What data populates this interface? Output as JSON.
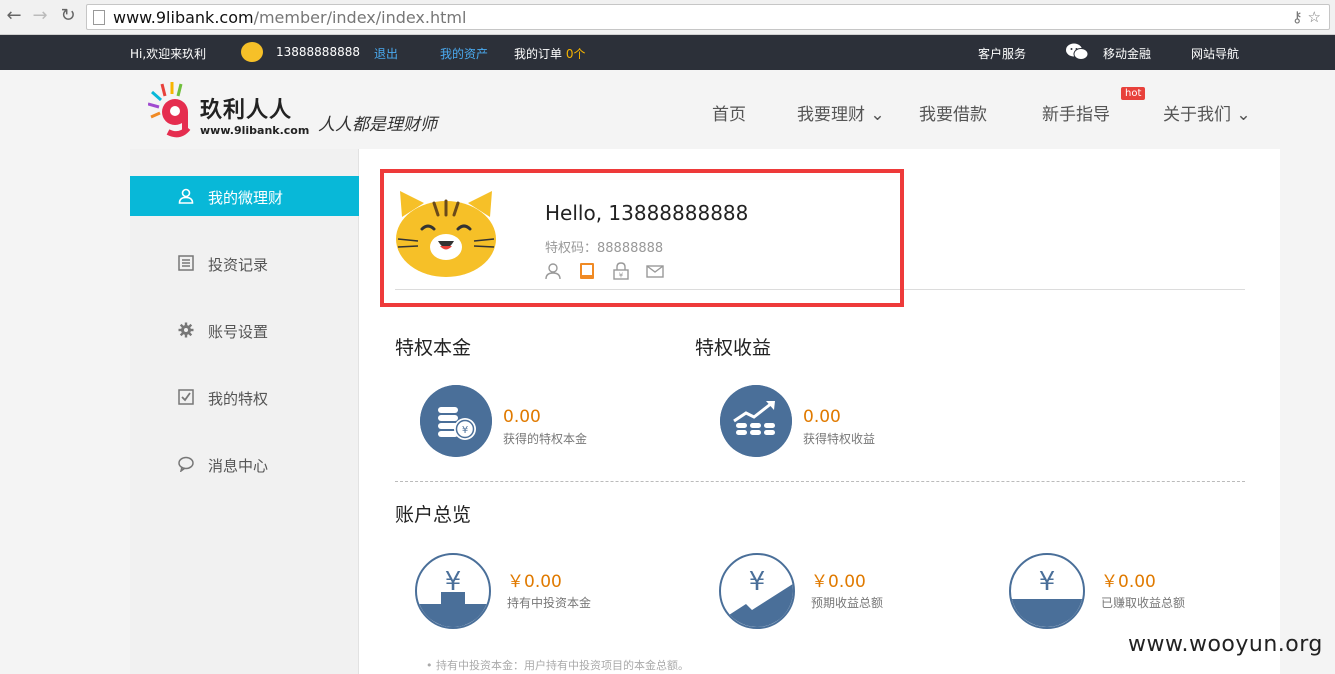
{
  "browser": {
    "url_host": "www.9libank.com",
    "url_path": "/member/index/index.html"
  },
  "topbar": {
    "greeting": "Hi,欢迎来玖利",
    "phone": "13888888888",
    "logout": "退出",
    "my_assets": "我的资产",
    "my_orders": "我的订单",
    "orders_count": "0个",
    "customer_service": "客户服务",
    "mobile_finance": "移动金融",
    "site_nav": "网站导航"
  },
  "header": {
    "logo_name": "玖利人人",
    "logo_url": "www.9libank.com",
    "slogan": "人人都是理财师",
    "nav": [
      {
        "label": "首页"
      },
      {
        "label": "我要理财 ⌄"
      },
      {
        "label": "我要借款"
      },
      {
        "label": "新手指导"
      },
      {
        "label": "关于我们 ⌄"
      }
    ],
    "hot_badge": "hot"
  },
  "sidebar": {
    "items": [
      {
        "label": "我的微理财",
        "icon": "user-icon",
        "active": true
      },
      {
        "label": "投资记录",
        "icon": "list-icon"
      },
      {
        "label": "账号设置",
        "icon": "gear-icon"
      },
      {
        "label": "我的特权",
        "icon": "checkbox-icon"
      },
      {
        "label": "消息中心",
        "icon": "chat-bubble-icon"
      }
    ]
  },
  "profile": {
    "hello": "Hello, 13888888888",
    "privilege_code": "特权码：88888888"
  },
  "privilege": {
    "principal_title": "特权本金",
    "principal_value": "0.00",
    "principal_sub": "获得的特权本金",
    "income_title": "特权收益",
    "income_value": "0.00",
    "income_sub": "获得特权收益"
  },
  "overview": {
    "title": "账户总览",
    "items": [
      {
        "value": "￥0.00",
        "label": "持有中投资本金"
      },
      {
        "value": "￥0.00",
        "label": "预期收益总额"
      },
      {
        "value": "￥0.00",
        "label": "已赚取收益总额"
      }
    ],
    "note": "• 持有中投资本金：用户持有中投资项目的本金总额。"
  },
  "colors": {
    "accent": "#08b8d8",
    "highlight": "#ee3a3a",
    "value_orange": "#e07a00",
    "icon_blue": "#4a6f99"
  },
  "watermark": "www.wooyun.org"
}
